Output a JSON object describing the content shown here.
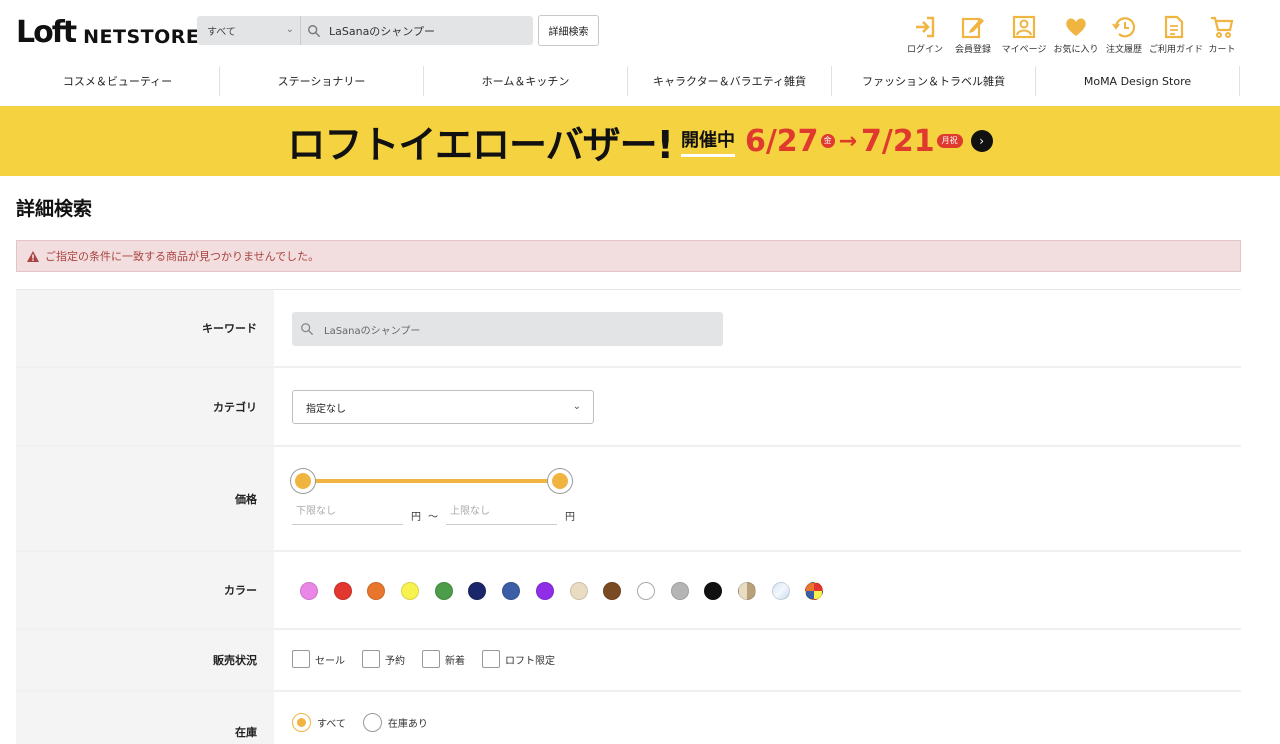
{
  "header": {
    "logo_mark": "Loft",
    "logo_text": "NETSTORE",
    "search_category": "すべて",
    "search_value": "LaSanaのシャンプー",
    "advanced_search_label": "詳細検索",
    "utility": [
      {
        "label": "ログイン",
        "icon": "login-icon"
      },
      {
        "label": "会員登録",
        "icon": "register-icon"
      },
      {
        "label": "マイページ",
        "icon": "mypage-icon"
      },
      {
        "label": "お気に入り",
        "icon": "heart-icon"
      },
      {
        "label": "注文履歴",
        "icon": "history-icon"
      },
      {
        "label": "ご利用ガイド",
        "icon": "guide-icon"
      },
      {
        "label": "カート",
        "icon": "cart-icon"
      }
    ]
  },
  "nav": [
    "コスメ＆ビューティー",
    "ステーショナリー",
    "ホーム＆キッチン",
    "キャラクター＆バラエティ雑貨",
    "ファッション＆トラベル雑貨",
    "MoMA Design Store"
  ],
  "banner": {
    "title": "ロフトイエローバザー!",
    "status": "開催中",
    "start": "6/27",
    "start_day": "金",
    "end": "7/21",
    "end_day": "月祝"
  },
  "page": {
    "title": "詳細検索",
    "alert": "ご指定の条件に一致する商品が見つかりませんでした。"
  },
  "form": {
    "keyword_label": "キーワード",
    "keyword_value": "LaSanaのシャンプー",
    "category_label": "カテゴリ",
    "category_value": "指定なし",
    "price_label": "価格",
    "price_min_placeholder": "下限なし",
    "price_max_placeholder": "上限なし",
    "price_unit": "円",
    "price_sep": "〜",
    "color_label": "カラー",
    "colors": [
      "#ea86e6",
      "#e2362f",
      "#e8762d",
      "#f7f24e",
      "#4c9c49",
      "#1a2669",
      "#3c5ea6",
      "#8f2ee6",
      "#e8dcc2",
      "#7a4a23",
      "#ffffff",
      "#b5b5b5",
      "#111111",
      "split-beige",
      "light-blue",
      "multi"
    ],
    "sale_label": "販売状況",
    "sale_options": [
      "セール",
      "予約",
      "新着",
      "ロフト限定"
    ],
    "stock_label": "在庫",
    "stock_options": [
      "すべて",
      "在庫あり"
    ],
    "stock_selected": 0
  },
  "colors": {
    "accent": "#f0b440",
    "banner_bg": "#f5d23f",
    "banner_red": "#e03a2e",
    "alert_bg": "#f2dede",
    "alert_text": "#a94442"
  }
}
